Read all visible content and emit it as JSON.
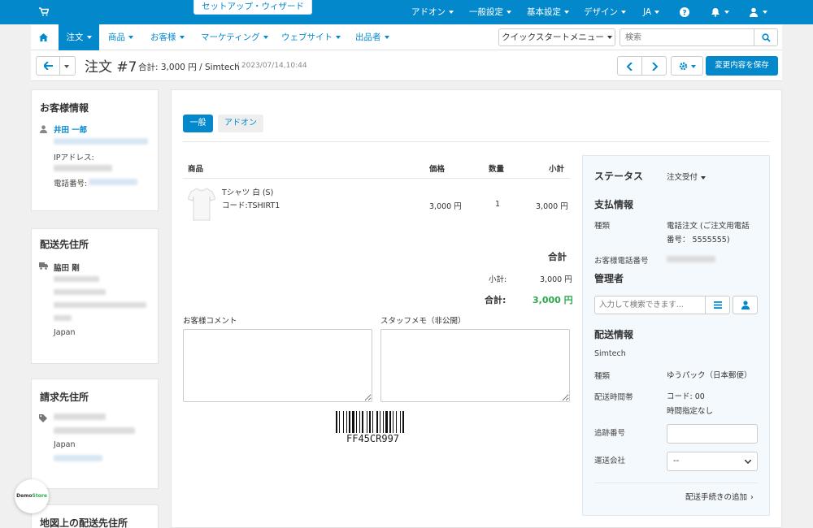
{
  "topbar": {
    "wizard": "セットアップ・ウィザード",
    "menus": [
      "アドオン",
      "一般設定",
      "基本設定",
      "デザイン",
      "JA"
    ]
  },
  "nav": {
    "items": [
      "注文",
      "商品",
      "お客様",
      "マーケティング",
      "ウェブサイト",
      "出品者"
    ],
    "quickstart": "クイックスタートメニュー",
    "search_placeholder": "検索"
  },
  "header": {
    "title": "注文 #7",
    "total": "合計: 3,000 円 / Simtech",
    "date": "/ 2023/07/14,10:44",
    "save": "変更内容を保存"
  },
  "sidebar": {
    "customer": {
      "title": "お客様情報",
      "name": "井田 一郎",
      "ip_label": "IPアドレス:",
      "phone_label": "電話番号:"
    },
    "shipping": {
      "title": "配送先住所",
      "name": "脇田 剛",
      "country": "Japan"
    },
    "billing": {
      "title": "請求先住所",
      "country": "Japan"
    },
    "map": {
      "title": "地図上の配送先住所"
    },
    "demo_badge": {
      "demo": "Demo",
      "store": "Store"
    }
  },
  "tabs": [
    "一般",
    "アドオン"
  ],
  "products": {
    "headers": [
      "商品",
      "価格",
      "数量",
      "小計"
    ],
    "rows": [
      {
        "name": "Tシャツ 白 (S)",
        "code": "コード:TSHIRT1",
        "price": "3,000 円",
        "qty": "1",
        "subtotal": "3,000 円"
      }
    ]
  },
  "totals": {
    "title": "合計",
    "subtotal_label": "小計:",
    "subtotal": "3,000 円",
    "total_label": "合計:",
    "total": "3,000 円"
  },
  "comments": {
    "customer": "お客様コメント",
    "staff": "スタッフメモ（非公開）"
  },
  "barcode": "FF45CR997",
  "status_panel": {
    "status_title": "ステータス",
    "status_value": "注文受付",
    "payment_title": "支払情報",
    "type_label": "種類",
    "payment_type_1": "電話注文 (ご注文用電話",
    "payment_type_2": "番号： 5555555)",
    "phone_label": "お客様電話番号",
    "admin_title": "管理者",
    "admin_placeholder": "入力して検索できます...",
    "delivery_title": "配送情報",
    "vendor": "Simtech",
    "ship_type_label": "種類",
    "ship_type": "ゆうパック（日本郵便）",
    "time_label": "配送時間帯",
    "time_code": "コード: 00",
    "time_value": "時間指定なし",
    "tracking_label": "追跡番号",
    "carrier_label": "運送会社",
    "carrier_value": "--",
    "add_procedure": "配送手続きの追加"
  },
  "colors": {
    "accent": "#0388cc",
    "total_green": "#2aa84a"
  }
}
